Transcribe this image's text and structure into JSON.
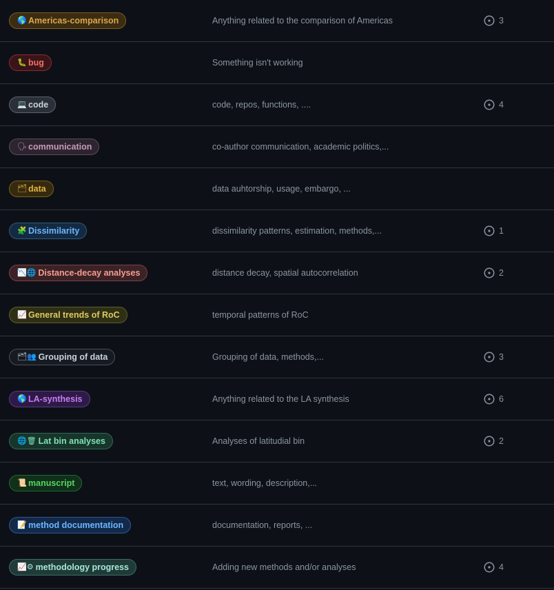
{
  "labels": [
    {
      "slug": "americas-comparison",
      "emoji": "🌎",
      "emoji_name": "globe-americas-icon",
      "name": "Americas-comparison",
      "description": "Anything related to the comparison of Americas",
      "issues": "3",
      "color": "#d9a84a",
      "bg": "#3b2c12",
      "border": "#7d5d26"
    },
    {
      "slug": "bug",
      "emoji": "🐛",
      "emoji_name": "bug-icon",
      "name": "bug",
      "description": "Something isn't working",
      "issues": "",
      "color": "#f47067",
      "bg": "#3a1418",
      "border": "#8a2c34"
    },
    {
      "slug": "code",
      "emoji": "💻",
      "emoji_name": "laptop-icon",
      "name": "code",
      "description": "code, repos, functions, ....",
      "issues": "4",
      "color": "#c9d1d9",
      "bg": "#2b3038",
      "border": "#5a626c"
    },
    {
      "slug": "communication",
      "emoji": "🗣",
      "emoji_name": "speaking-head-icon",
      "name": "communication",
      "description": "co-author communication, academic politics,...",
      "issues": "",
      "color": "#c59bb9",
      "bg": "#2e2430",
      "border": "#5b4a5a"
    },
    {
      "slug": "data",
      "emoji": "🗂",
      "emoji_name": "card-index-dividers-icon",
      "name": "data",
      "description": "data auhtorship, usage, embargo, ...",
      "issues": "",
      "color": "#e3b341",
      "bg": "#352a0e",
      "border": "#7a6020"
    },
    {
      "slug": "dissimilarity",
      "emoji": "🧩",
      "emoji_name": "puzzle-piece-icon",
      "name": "Dissimilarity",
      "description": "dissimilarity patterns, estimation, methods,...",
      "issues": "1",
      "color": "#6cb6ff",
      "bg": "#132a42",
      "border": "#2f5a83"
    },
    {
      "slug": "distance-decay",
      "emoji": "📉🌐",
      "emoji_name": "chart-decreasing-globe-icon",
      "name": "Distance-decay analyses",
      "description": "distance decay, spatial autocorrelation",
      "issues": "2",
      "color": "#f69d8f",
      "bg": "#3b2226",
      "border": "#7d4248"
    },
    {
      "slug": "general-trends",
      "emoji": "📈",
      "emoji_name": "chart-increasing-icon",
      "name": "General trends of RoC",
      "description": "temporal patterns of RoC",
      "issues": "",
      "color": "#dccb5f",
      "bg": "#2f2f16",
      "border": "#5f5e2b"
    },
    {
      "slug": "grouping",
      "emoji": "🗂👥",
      "emoji_name": "dividers-people-icon",
      "name": "Grouping of data",
      "description": "Grouping of data, methods,...",
      "issues": "3",
      "color": "#c9d1d9",
      "bg": "#161b22",
      "border": "#4a5059"
    },
    {
      "slug": "la-synthesis",
      "emoji": "🌎",
      "emoji_name": "globe-americas-icon",
      "name": "LA-synthesis",
      "description": "Anything related to the LA synthesis",
      "issues": "6",
      "color": "#c97cf5",
      "bg": "#2d1a46",
      "border": "#5a3a86"
    },
    {
      "slug": "lat-bin",
      "emoji": "🌐🗑",
      "emoji_name": "globe-wastebasket-icon",
      "name": "Lat bin analyses",
      "description": "Analyses of latitudial bin",
      "issues": "2",
      "color": "#7ee2b8",
      "bg": "#17352b",
      "border": "#2f6b55"
    },
    {
      "slug": "manuscript",
      "emoji": "📜",
      "emoji_name": "scroll-icon",
      "name": "manuscript",
      "description": "text, wording, description,...",
      "issues": "",
      "color": "#56d364",
      "bg": "#10301a",
      "border": "#1f6b30"
    },
    {
      "slug": "method-documentation",
      "emoji": "📝",
      "emoji_name": "memo-icon",
      "name": "method documentation",
      "description": "documentation, reports, ...",
      "issues": "",
      "color": "#6cb6ff",
      "bg": "#13294a",
      "border": "#2f558f"
    },
    {
      "slug": "methodology-progress",
      "emoji": "📈⚙",
      "emoji_name": "chart-gear-icon",
      "name": "methodology progress",
      "description": "Adding new methods and/or analyses",
      "issues": "4",
      "color": "#a8e6d9",
      "bg": "#1f3a37",
      "border": "#3d6c66"
    }
  ]
}
